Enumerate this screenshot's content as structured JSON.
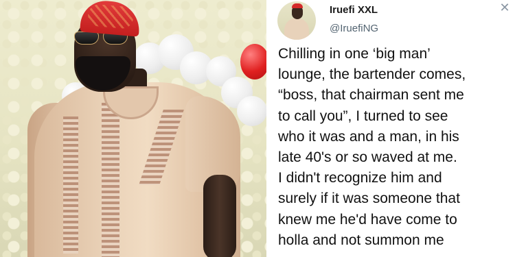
{
  "photo": {
    "description_icon": "portrait-photo"
  },
  "tweet": {
    "author_name": "Iruefi XXL",
    "handle": "@IruefiNG",
    "close_icon": "✕",
    "text": "Chilling in one ‘big man’\nlounge, the bartender comes,\n“boss, that chairman sent me\nto call you”, I turned to see\nwho it was and a man, in his\nlate 40's or so waved at me.\nI didn't recognize him and\nsurely if it was someone that\nknew me he'd have come to\nholla and not summon me"
  }
}
